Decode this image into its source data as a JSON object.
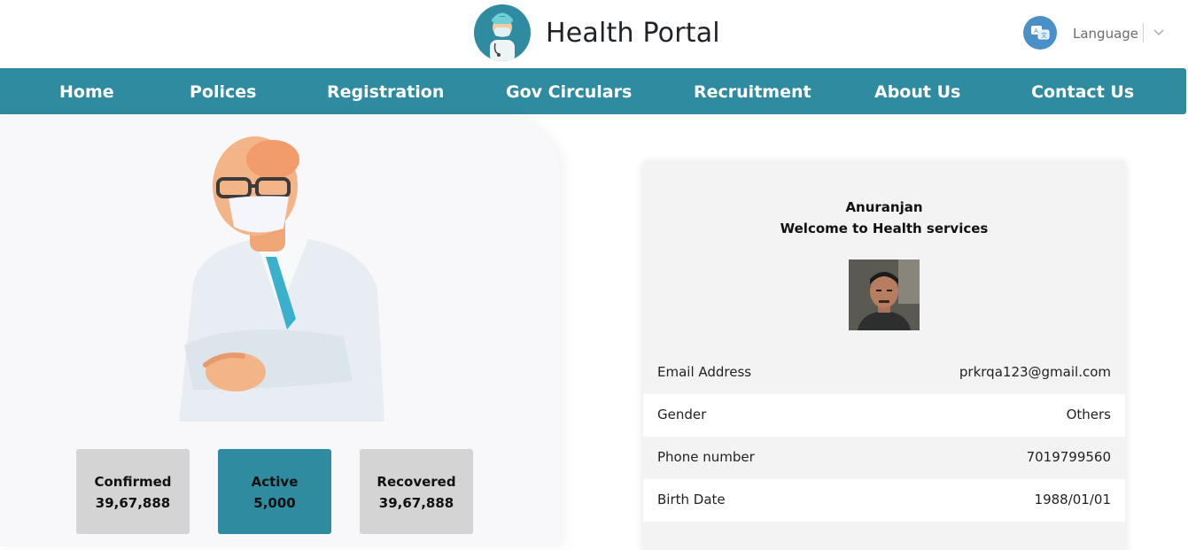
{
  "header": {
    "title": "Health Portal",
    "language_label": "Language"
  },
  "nav": {
    "items": [
      "Home",
      "Polices",
      "Registration",
      "Gov Circulars",
      "Recruitment",
      "About Us",
      "Contact Us"
    ]
  },
  "stats": [
    {
      "label": "Confirmed",
      "value": "39,67,888"
    },
    {
      "label": "Active",
      "value": "5,000"
    },
    {
      "label": "Recovered",
      "value": "39,67,888"
    }
  ],
  "profile": {
    "name": "Anuranjan",
    "welcome": "Welcome to Health services",
    "rows": [
      {
        "label": "Email Address",
        "value": "prkrqa123@gmail.com"
      },
      {
        "label": "Gender",
        "value": "Others"
      },
      {
        "label": "Phone number",
        "value": "7019799560"
      },
      {
        "label": "Birth Date",
        "value": "1988/01/01"
      }
    ]
  },
  "colors": {
    "primary": "#2f8ba0",
    "stat_inactive": "#d4d4d4",
    "card_bg": "#f2f3f2"
  }
}
